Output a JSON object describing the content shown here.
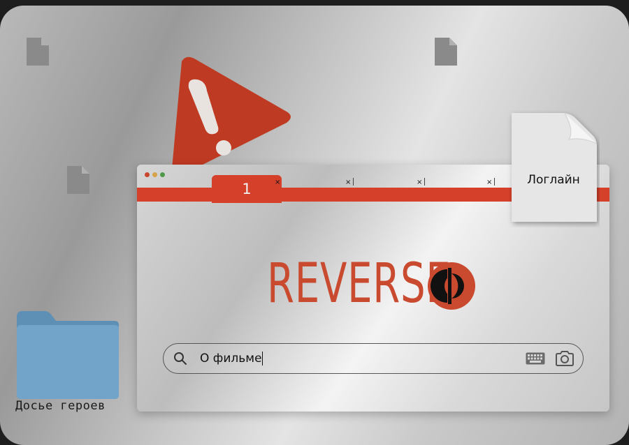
{
  "desktop": {
    "folder_label": "Досье героев",
    "login_file_label": "Логлайн"
  },
  "browser": {
    "active_tab_label": "1",
    "tab_close_glyph": "×",
    "logo_text": "REVERSE",
    "search": {
      "value": "О фильме",
      "placeholder": ""
    }
  },
  "icons": {
    "warning": "warning-triangle-icon",
    "document": "document-icon",
    "folder": "folder-icon",
    "search": "search-icon",
    "keyboard": "keyboard-icon",
    "camera": "camera-icon",
    "logo_mark": "reverse-logo-mark-icon"
  },
  "colors": {
    "accent": "#d5402a",
    "warning": "#c0392b",
    "folder": "#6fa1c6"
  }
}
